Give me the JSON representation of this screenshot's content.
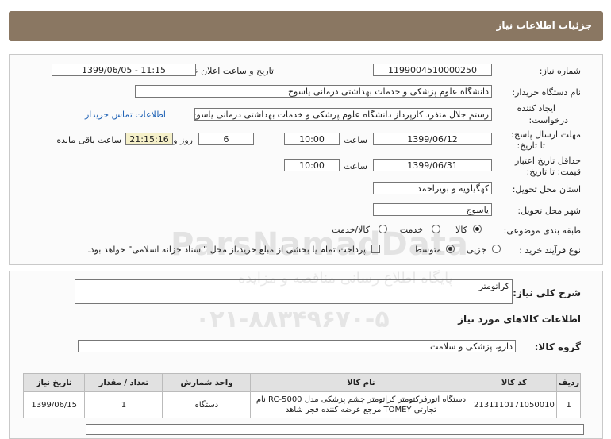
{
  "header": {
    "title": "جزئیات اطلاعات نیاز"
  },
  "form": {
    "need_number_label": "شماره نیاز:",
    "need_number": "1199004510000250",
    "announce_label": "تاریخ و ساعت اعلان عمومی:",
    "announce_value": "1399/06/05 - 11:15",
    "buyer_org_label": "نام دستگاه خریدار:",
    "buyer_org": "دانشگاه علوم پزشکی و خدمات بهداشتی درمانی یاسوج",
    "requester_label_1": "ایجاد کننده",
    "requester_label_2": "درخواست:",
    "requester": "رستم جلال متفرد کارپرداز دانشگاه علوم پزشکی و خدمات بهداشتی درمانی یاسوج",
    "contact_link": "اطلاعات تماس خریدار",
    "reply_deadline_label_1": "مهلت ارسال پاسخ:",
    "reply_deadline_label_2": "تا تاریخ:",
    "reply_date": "1399/06/12",
    "time_label": "ساعت",
    "reply_time": "10:00",
    "days_value": "6",
    "days_label": "روز و",
    "remaining_time": "21:15:16",
    "remaining_label": "ساعت باقی مانده",
    "validity_label_1": "حداقل تاریخ اعتبار",
    "validity_label_2": "قیمت: تا تاریخ:",
    "validity_date": "1399/06/31",
    "validity_time": "10:00",
    "province_label": "استان محل تحویل:",
    "province": "کهگیلویه و بویراحمد",
    "city_label": "شهر محل تحویل:",
    "city": "یاسوج",
    "category_label": "طبقه بندی موضوعی:",
    "category_options": [
      "کالا",
      "خدمت",
      "کالا/خدمت"
    ],
    "category_selected": "کالا",
    "purchase_type_label": "نوع فرآیند خرید :",
    "purchase_options": [
      "جزیی",
      "متوسط"
    ],
    "purchase_selected": "متوسط",
    "payment_note": "پرداخت تمام یا بخشی از مبلغ خرید،از محل \"اسناد خزانه اسلامی\" خواهد بود."
  },
  "details": {
    "description_label": "شرح کلی نیاز:",
    "description": "کراتومتر",
    "goods_info_title": "اطلاعات کالاهای مورد نیاز",
    "goods_group_label": "گروه کالا:",
    "goods_group": "دارو، پزشکی و سلامت"
  },
  "table": {
    "headers": [
      "ردیف",
      "کد کالا",
      "نام کالا",
      "واحد شمارش",
      "تعداد / مقدار",
      "تاریخ نیاز"
    ],
    "rows": [
      {
        "row": "1",
        "code": "2131110171050010",
        "name": "دستگاه اتورفرکتومتر کراتومتر چشم پزشکی مدل RC-5000 نام تجارتی TOMEY مرجع عرضه کننده فجر شاهد",
        "unit": "دستگاه",
        "qty": "1",
        "date": "1399/06/15"
      }
    ]
  },
  "watermark": {
    "line1": "ParsNamadData",
    "line2": "۰۲۱-۸۸۳۴۹۶۷۰-۵",
    "line3": "پایگاه اطلاع رسانی مناقصه و مزایده"
  }
}
